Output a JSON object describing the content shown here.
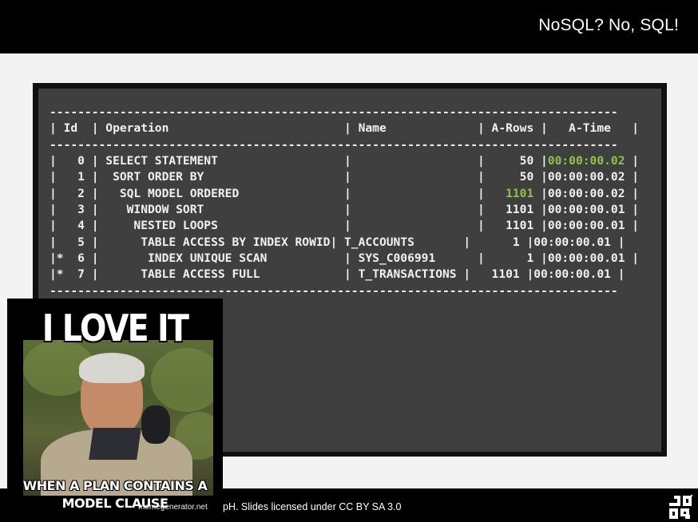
{
  "slide": {
    "title": "NoSQL? No, SQL!",
    "footer_text": "pH. Slides licensed under CC BY SA 3.0"
  },
  "plan": {
    "separator": "---------------------------------------------------------------------------------",
    "header": "| Id  | Operation                         | Name             | A-Rows |   A-Time   |",
    "rows": [
      {
        "pre": "|   0 | SELECT STATEMENT                  |                  |     50 |",
        "time": "00:00:00.02",
        "post": " |",
        "time_green": true
      },
      {
        "pre": "|   1 |  SORT ORDER BY                    |                  |     50 |",
        "time": "00:00:00.02",
        "post": " |"
      },
      {
        "pre": "|   2 |   SQL MODEL ORDERED               |                  |   ",
        "rows_green": "1101",
        "mid": " |",
        "time": "00:00:00.02",
        "post": " |"
      },
      {
        "pre": "|   3 |    WINDOW SORT                    |                  |   1101 |",
        "time": "00:00:00.01",
        "post": " |"
      },
      {
        "pre": "|   4 |     NESTED LOOPS                  |                  |   1101 |",
        "time": "00:00:00.01",
        "post": " |"
      },
      {
        "pre": "|   5 |      TABLE ACCESS BY INDEX ROWID| T_ACCOUNTS       |      1 |",
        "time": "00:00:00.01",
        "post": " |"
      },
      {
        "pre": "|*  6 |       INDEX UNIQUE SCAN           | SYS_C006991      |      1 |",
        "time": "00:00:00.01",
        "post": " |"
      },
      {
        "pre": "|*  7 |      TABLE ACCESS FULL            | T_TRANSACTIONS |   1101 |",
        "time": "00:00:00.01",
        "post": " |"
      }
    ]
  },
  "meme": {
    "top_text": "I LOVE IT",
    "bottom_text": "WHEN A PLAN CONTAINS A MODEL CLAUSE",
    "credit": "memegenerator.net"
  },
  "colors": {
    "highlight": "#8fc34a"
  }
}
